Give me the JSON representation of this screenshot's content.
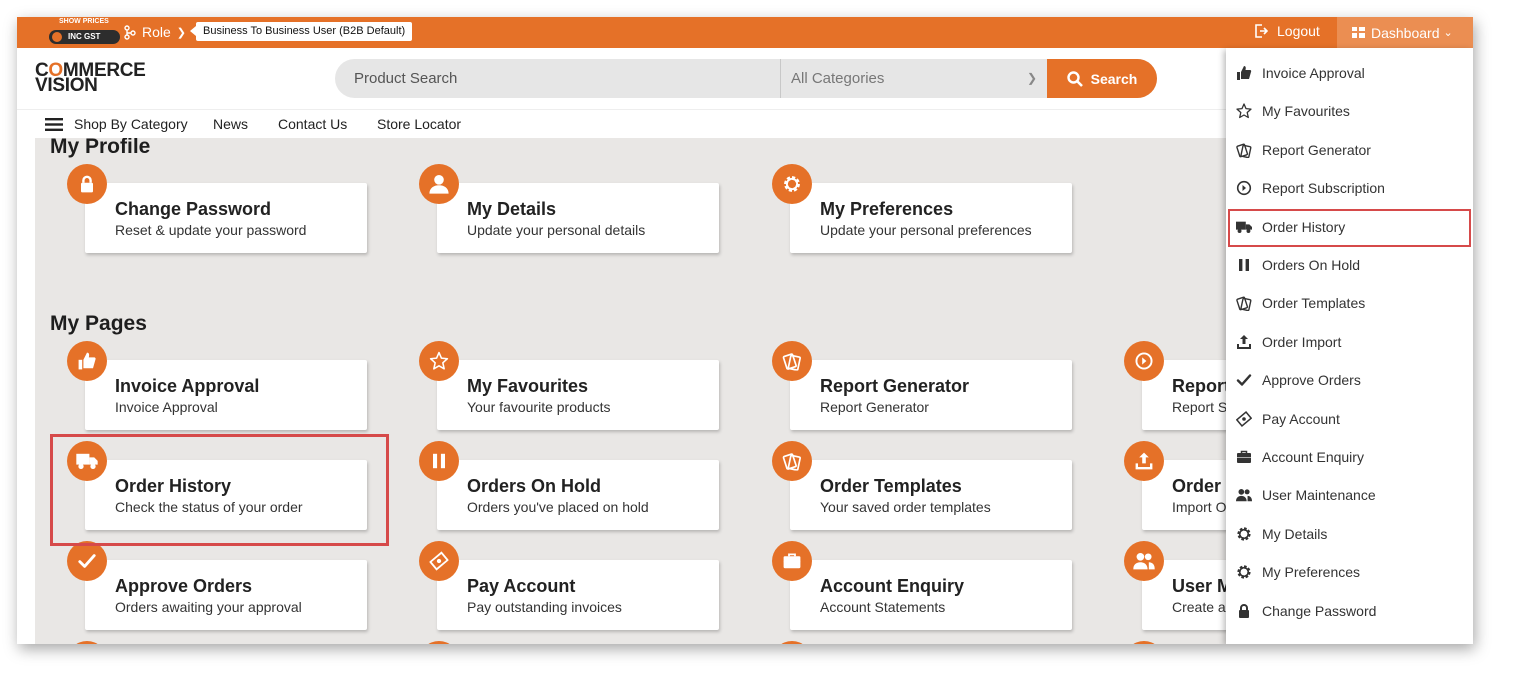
{
  "topbar": {
    "price_toggle_caption": "SHOW PRICES",
    "price_toggle_value": "INC GST",
    "role_label": "Role",
    "role_tag": "Business To Business User (B2B Default)",
    "logout_label": "Logout",
    "dashboard_label": "Dashboard"
  },
  "header": {
    "logo_line1_a": "C",
    "logo_line1_o": "O",
    "logo_line1_b": "MMERCE",
    "logo_line2": "VISION",
    "search_placeholder": "Product Search",
    "category_select": "All Categories",
    "search_button": "Search"
  },
  "nav": [
    "Shop By Category",
    "News",
    "Contact Us",
    "Store Locator"
  ],
  "profile": {
    "title": "My Profile",
    "cards": [
      {
        "title": "Change Password",
        "subtitle": "Reset & update your password",
        "icon": "lock-icon"
      },
      {
        "title": "My Details",
        "subtitle": "Update your personal details",
        "icon": "user-icon"
      },
      {
        "title": "My Preferences",
        "subtitle": "Update your personal preferences",
        "icon": "gear-icon"
      }
    ]
  },
  "pages": {
    "title": "My Pages",
    "cards": [
      {
        "title": "Invoice Approval",
        "subtitle": "Invoice Approval",
        "icon": "thumbs-up-icon"
      },
      {
        "title": "My Favourites",
        "subtitle": "Your favourite products",
        "icon": "star-icon"
      },
      {
        "title": "Report Generator",
        "subtitle": "Report Generator",
        "icon": "report-icon"
      },
      {
        "title": "Report",
        "subtitle": "Report S",
        "icon": "arrow-circle-icon"
      },
      {
        "title": "Order History",
        "subtitle": "Check the status of your order",
        "icon": "truck-icon"
      },
      {
        "title": "Orders On Hold",
        "subtitle": "Orders you've placed on hold",
        "icon": "pause-icon"
      },
      {
        "title": "Order Templates",
        "subtitle": "Your saved order templates",
        "icon": "report-icon"
      },
      {
        "title": "Order",
        "subtitle": "Import O",
        "icon": "upload-icon"
      },
      {
        "title": "Approve Orders",
        "subtitle": "Orders awaiting your approval",
        "icon": "check-icon"
      },
      {
        "title": "Pay Account",
        "subtitle": "Pay outstanding invoices",
        "icon": "money-icon"
      },
      {
        "title": "Account Enquiry",
        "subtitle": "Account Statements",
        "icon": "briefcase-icon"
      },
      {
        "title": "User M",
        "subtitle": "Create a",
        "icon": "users-icon"
      }
    ]
  },
  "dashboard_menu": [
    {
      "label": "Invoice Approval",
      "icon": "thumbs-up-icon"
    },
    {
      "label": "My Favourites",
      "icon": "star-icon"
    },
    {
      "label": "Report Generator",
      "icon": "report-icon"
    },
    {
      "label": "Report Subscription",
      "icon": "arrow-circle-icon"
    },
    {
      "label": "Order History",
      "icon": "truck-icon"
    },
    {
      "label": "Orders On Hold",
      "icon": "pause-icon"
    },
    {
      "label": "Order Templates",
      "icon": "report-icon"
    },
    {
      "label": "Order Import",
      "icon": "upload-icon"
    },
    {
      "label": "Approve Orders",
      "icon": "check-icon"
    },
    {
      "label": "Pay Account",
      "icon": "money-icon"
    },
    {
      "label": "Account Enquiry",
      "icon": "briefcase-icon"
    },
    {
      "label": "User Maintenance",
      "icon": "users-icon"
    },
    {
      "label": "My Details",
      "icon": "gear-icon"
    },
    {
      "label": "My Preferences",
      "icon": "gear-icon"
    },
    {
      "label": "Change Password",
      "icon": "lock-icon"
    }
  ],
  "colors": {
    "brand": "#e57128",
    "highlight": "#d64a4a",
    "panel_bg": "#e9e7e5"
  }
}
